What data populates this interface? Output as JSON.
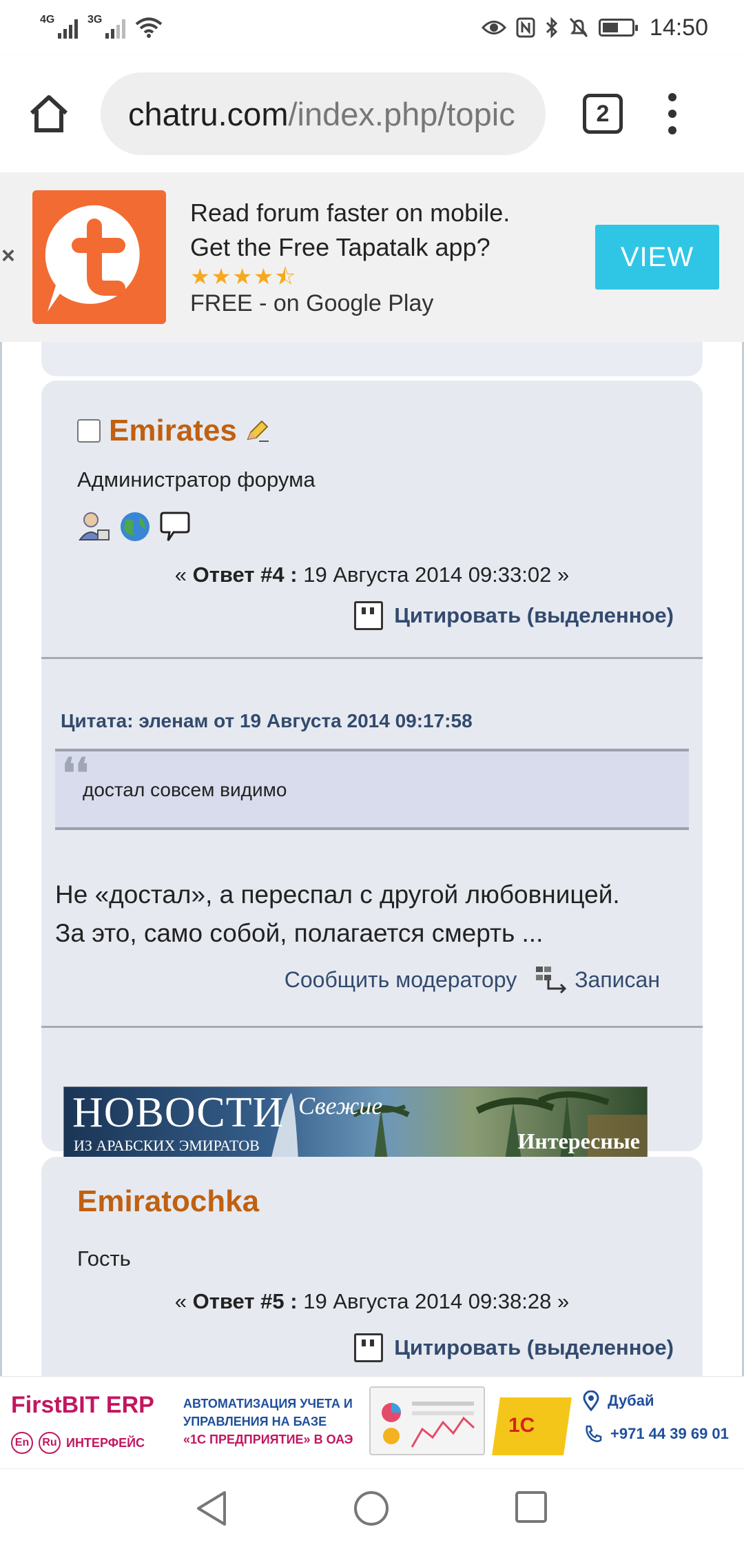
{
  "status_bar": {
    "signal1": "4G",
    "signal2": "3G",
    "time": "14:50"
  },
  "browser": {
    "url_domain": "chatru.com",
    "url_path": "/index.php/topic",
    "tab_count": "2"
  },
  "tapatalk": {
    "close": "×",
    "line1": "Read forum faster on mobile.",
    "line2": "Get the Free Tapatalk app?",
    "stars": "★★★★⯪",
    "store": "FREE - on Google Play",
    "view_label": "VIEW"
  },
  "posts": [
    {
      "author": "Emirates",
      "role": "Администратор форума",
      "reply_prefix": "« ",
      "reply_label": "Ответ #4 :",
      "reply_date": " 19 Августа 2014 09:33:02 »",
      "quote_label": "Цитировать (выделенное)",
      "quote_header": "Цитата: эленам от 19 Августа 2014 09:17:58",
      "quote_mark": "❛❛",
      "quote_text": "достал совсем видимо",
      "body_line1": "Не «достал», а переспал с другой любовницей.",
      "body_line2": "За это, само собой, полагается смерть ...",
      "report_label": "Сообщить модератору",
      "written_label": "Записан",
      "banner": {
        "title": "НОВОСТИ",
        "fresh": "Свежие",
        "subtitle": "ИЗ АРАБСКИХ ЭМИРАТОВ",
        "interesting": "Интересные"
      }
    },
    {
      "author": "Emiratochka",
      "role": "Гость",
      "reply_prefix": "« ",
      "reply_label": "Ответ #5 :",
      "reply_date": " 19 Августа 2014 09:38:28 »",
      "quote_label": "Цитировать (выделенное)"
    }
  ],
  "ad": {
    "brand": "FirstBIT ERP",
    "badge_en": "En",
    "badge_ru": "Ru",
    "interface": "ИНТЕРФЕЙС",
    "desc1": "АВТОМАТИЗАЦИЯ УЧЕТА И",
    "desc2": "УПРАВЛЕНИЯ НА БАЗЕ",
    "desc3": "«1С ПРЕДПРИЯТИЕ» В ОАЭ",
    "box_label": "1С",
    "city": "Дубай",
    "phone": "+971 44 39 69 01"
  }
}
